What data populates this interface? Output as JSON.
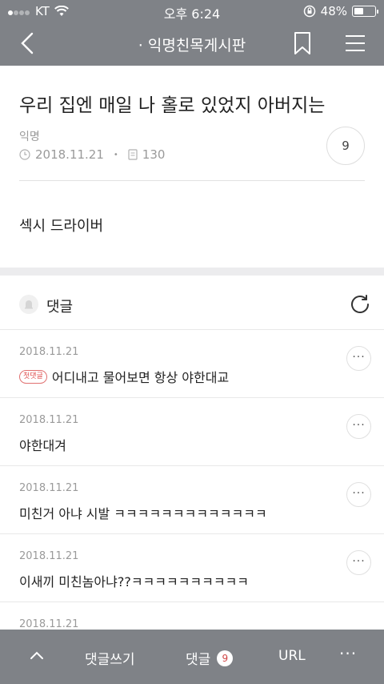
{
  "status_bar": {
    "carrier": "KT",
    "time": "오후 6:24",
    "battery": "48%",
    "battery_level": 0.48
  },
  "navbar": {
    "title": "· 익명친목게시판"
  },
  "post": {
    "title": "우리 집엔 매일 나 홀로 있었지 아버지는",
    "author": "익명",
    "date": "2018.11.21",
    "views": "130",
    "comment_count": "9",
    "body": "섹시 드라이버"
  },
  "comments_section": {
    "label": "댓글",
    "items": [
      {
        "date": "2018.11.21",
        "badge": "첫댓글",
        "text": "어디내고 물어보면 항상 야한대교"
      },
      {
        "date": "2018.11.21",
        "badge": "",
        "text": "야한대겨"
      },
      {
        "date": "2018.11.21",
        "badge": "",
        "text": "미친거 아냐 시발 ㅋㅋㅋㅋㅋㅋㅋㅋㅋㅋㅋㅋㅋ"
      },
      {
        "date": "2018.11.21",
        "badge": "",
        "text": "이새끼 미친놈아냐??ㅋㅋㅋㅋㅋㅋㅋㅋㅋㅋ"
      },
      {
        "date": "2018.11.21",
        "badge": "",
        "text": ""
      }
    ]
  },
  "bottom_bar": {
    "write_label": "댓글쓰기",
    "comments_label": "댓글",
    "comments_count": "9",
    "url_label": "URL",
    "more_label": "···"
  },
  "colors": {
    "bar_bg": "#7f8287",
    "badge_red": "#e05050"
  }
}
